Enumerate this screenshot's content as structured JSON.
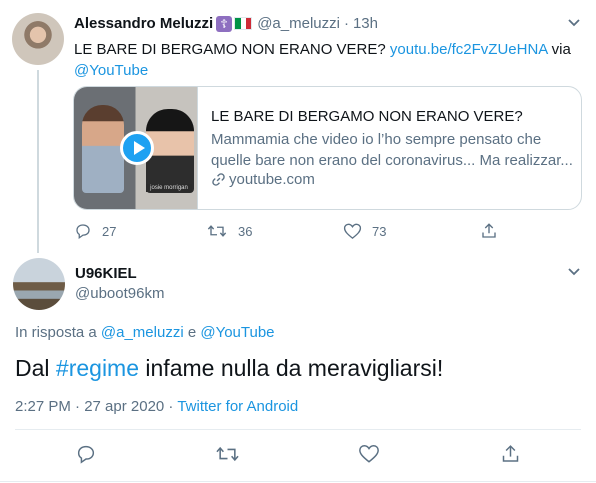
{
  "tweet1": {
    "author_name": "Alessandro Meluzzi",
    "badge_glyph": "☦",
    "flag_colors": [
      "#009246",
      "#ffffff",
      "#ce2b37"
    ],
    "handle": "@a_meluzzi",
    "separator": "·",
    "time": "13h",
    "text_plain": "LE BARE DI BERGAMO NON ERANO VERE? ",
    "text_link": "youtu.be/fc2FvZUeHNA",
    "text_via": " via",
    "text_mention": "@YouTube",
    "card": {
      "thumb_caption": "josie morrigan",
      "title": "LE BARE DI BERGAMO NON ERANO VERE?",
      "description": "Mammamia che video io l’ho sempre pensato che quelle bare non erano del coronavirus... Ma realizzar...",
      "domain": "youtube.com",
      "link_icon": "link-icon"
    },
    "actions": {
      "reply_count": "27",
      "retweet_count": "36",
      "like_count": "73"
    }
  },
  "tweet2": {
    "author_name": "U96KIEL",
    "handle": "@uboot96km",
    "reply_prefix": "In risposta a ",
    "reply_user1": "@a_meluzzi",
    "reply_and": " e ",
    "reply_user2": "@YouTube",
    "text_before": "Dal ",
    "hashtag": "#regime",
    "text_after": " infame nulla da meravigliarsi!",
    "timestamp": "2:27 PM · 27 apr 2020 · ",
    "source": "Twitter for Android"
  },
  "icons": {
    "chevron": "chevron-down-icon",
    "reply": "reply-icon",
    "retweet": "retweet-icon",
    "like": "like-icon",
    "share": "share-icon"
  },
  "colors": {
    "link_blue": "#1b95e0",
    "secondary_text": "#5b7083",
    "play_button": "#1da1f2",
    "badge_purple": "#8e6fc0"
  }
}
